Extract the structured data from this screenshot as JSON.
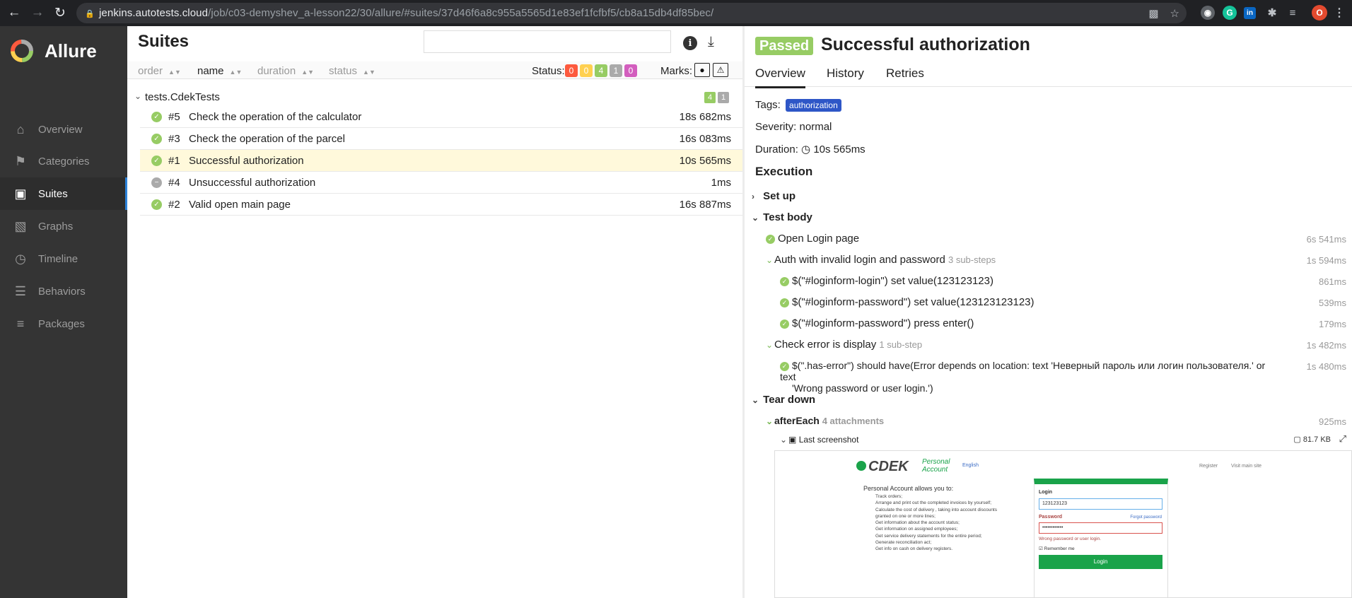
{
  "browser": {
    "url_host": "jenkins.autotests.cloud",
    "url_path": "/job/c03-demyshev_a-lesson22/30/allure/#suites/37d46f6a8c955a5565d1e83ef1fcfbf5/cb8a15db4df85bec/",
    "profile_initial": "O"
  },
  "nav": {
    "brand": "Allure",
    "items": [
      {
        "label": "Overview",
        "icon": "home-icon"
      },
      {
        "label": "Categories",
        "icon": "flag-icon"
      },
      {
        "label": "Suites",
        "icon": "briefcase-icon",
        "active": true
      },
      {
        "label": "Graphs",
        "icon": "bar-chart-icon"
      },
      {
        "label": "Timeline",
        "icon": "clock-icon"
      },
      {
        "label": "Behaviors",
        "icon": "list-icon"
      },
      {
        "label": "Packages",
        "icon": "align-left-icon"
      }
    ]
  },
  "suites": {
    "title": "Suites",
    "sort": {
      "order": "order",
      "name": "name",
      "duration": "duration",
      "status": "status"
    },
    "status_label": "Status:",
    "status_counts": [
      {
        "value": "0",
        "color": "#fd5a3e"
      },
      {
        "value": "0",
        "color": "#ffd050"
      },
      {
        "value": "4",
        "color": "#97cc64"
      },
      {
        "value": "1",
        "color": "#aaaaaa"
      },
      {
        "value": "0",
        "color": "#d35ebe"
      }
    ],
    "marks_label": "Marks:",
    "group": {
      "name": "tests.CdekTests",
      "passed": "4",
      "skipped": "1"
    },
    "tests": [
      {
        "num": "#5",
        "name": "Check the operation of the calculator",
        "duration": "18s 682ms",
        "status": "passed"
      },
      {
        "num": "#3",
        "name": "Check the operation of the parcel",
        "duration": "16s 083ms",
        "status": "passed"
      },
      {
        "num": "#1",
        "name": "Successful authorization",
        "duration": "10s 565ms",
        "status": "passed",
        "selected": true
      },
      {
        "num": "#4",
        "name": "Unsuccessful authorization",
        "duration": "1ms",
        "status": "skipped"
      },
      {
        "num": "#2",
        "name": "Valid open main page",
        "duration": "16s 887ms",
        "status": "passed"
      }
    ]
  },
  "details": {
    "status_badge": "Passed",
    "title": "Successful authorization",
    "tabs": [
      "Overview",
      "History",
      "Retries"
    ],
    "tags_label": "Tags:",
    "tag": "authorization",
    "severity": "Severity: normal",
    "duration_label": "Duration:",
    "duration": "10s 565ms",
    "execution_title": "Execution",
    "setup_label": "Set up",
    "test_body_label": "Test body",
    "steps": [
      {
        "name": "Open Login page",
        "duration": "6s 541ms"
      },
      {
        "name": "Auth with invalid login and password",
        "sub": "3 sub-steps",
        "duration": "1s 594ms"
      },
      {
        "name": "$(\"#loginform-login\") set value(123123123)",
        "duration": "861ms"
      },
      {
        "name": "$(\"#loginform-password\") set value(123123123123)",
        "duration": "539ms"
      },
      {
        "name": "$(\"#loginform-password\") press enter()",
        "duration": "179ms"
      },
      {
        "name": "Check error is display",
        "sub": "1 sub-step",
        "duration": "1s 482ms"
      },
      {
        "name": "$(\".has-error\") should have(Error depends on location: text 'Неверный пароль или логин пользователя.' or text",
        "name2": "'Wrong password or user login.')",
        "duration": "1s 480ms"
      }
    ],
    "teardown_label": "Tear down",
    "after_each": {
      "name": "afterEach",
      "sub": "4 attachments",
      "duration": "925ms"
    },
    "attachment": {
      "name": "Last screenshot",
      "size": "81.7 KB"
    }
  },
  "screenshot": {
    "brand": "CDEK",
    "brand_sub1": "Personal",
    "brand_sub2": "Account",
    "lang": "English",
    "register": "Register",
    "visit": "Visit main site",
    "intro": "Personal Account allows you to:",
    "bullets": [
      "Track orders;",
      "Arrange and print out the completed invoices by yourself;",
      "Calculate the cost of delivery , taking into account discounts",
      "granted on one or more lines;",
      "Get information about the account status;",
      "Get information on assigned employees;",
      "Get service delivery statements for the entire period;",
      "Generate reconciliation act;",
      "Get info on cash on delivery registers."
    ],
    "login_label": "Login",
    "login_value": "123123123",
    "password_label": "Password",
    "forgot": "Forgot password",
    "password_value": "••••••••••••",
    "error": "Wrong password or user login.",
    "remember": "Remember me",
    "login_button": "Login"
  }
}
